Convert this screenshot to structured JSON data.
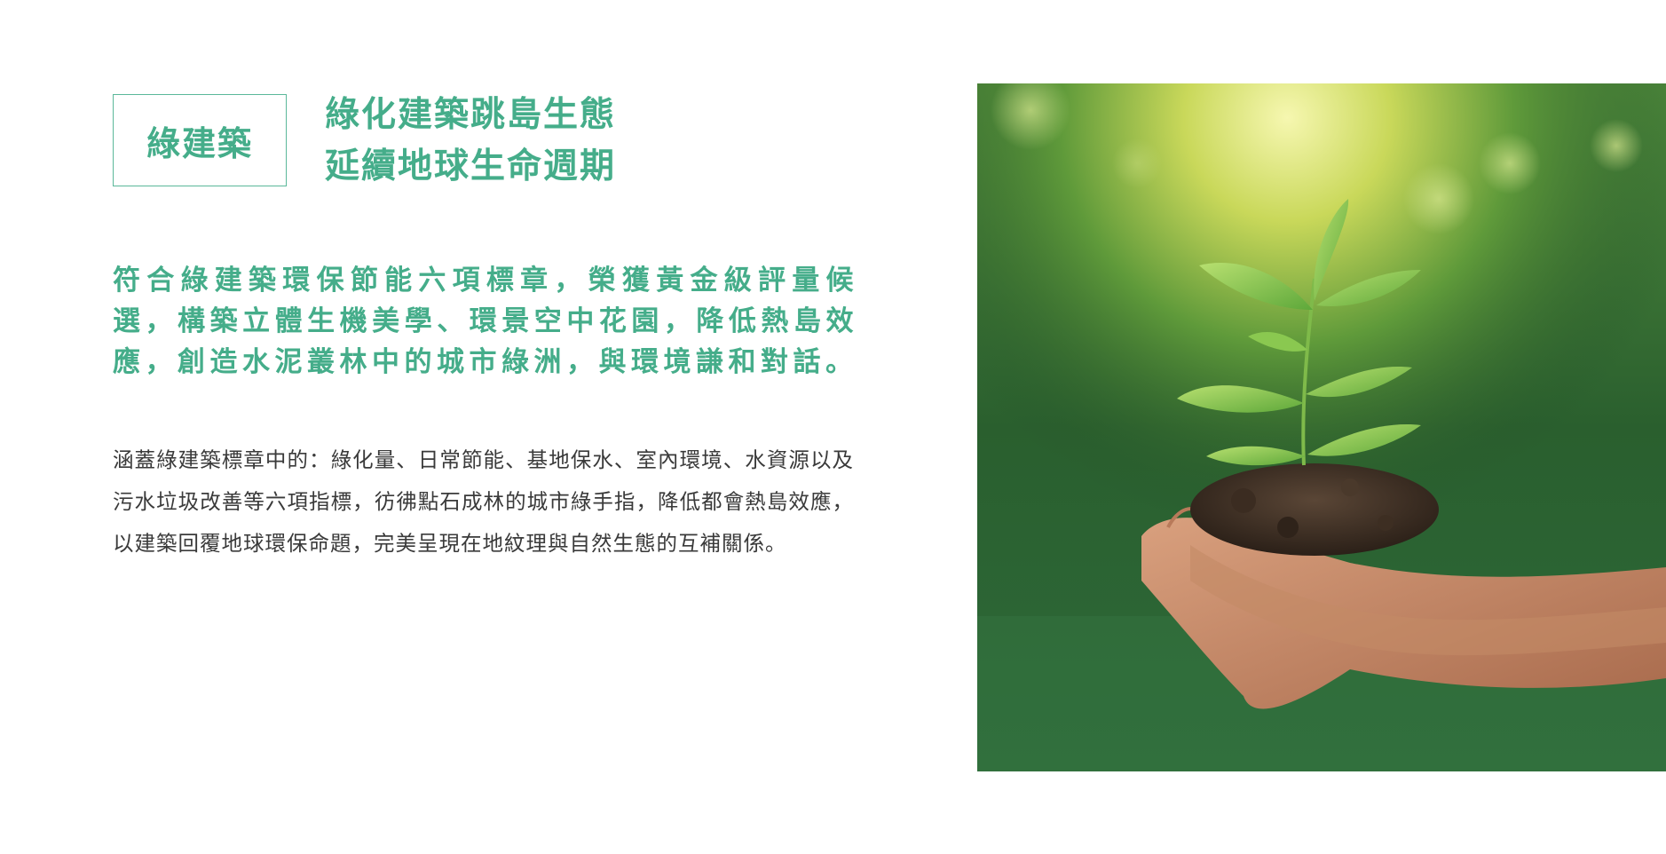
{
  "badge": {
    "label": "綠建築"
  },
  "headline": {
    "line1": "綠化建築跳島生態",
    "line2": "延續地球生命週期"
  },
  "lead_text": "符合綠建築環保節能六項標章，榮獲黃金級評量候選，構築立體生機美學、環景空中花園，降低熱島效應，創造水泥叢林中的城市綠洲，與環境謙和對話。",
  "body_text": "涵蓋綠建築標章中的：綠化量、日常節能、基地保水、室內環境、水資源以及污水垃圾改善等六項指標，彷彿點石成林的城市綠手指，降低都會熱島效應，以建築回覆地球環保命題，完美呈現在地紋理與自然生態的互補關係。",
  "photo": {
    "subject": "hands-holding-seedling-in-soil"
  },
  "colors": {
    "accent": "#45ad8a",
    "body": "#3a3a3a",
    "background": "#ffffff"
  }
}
